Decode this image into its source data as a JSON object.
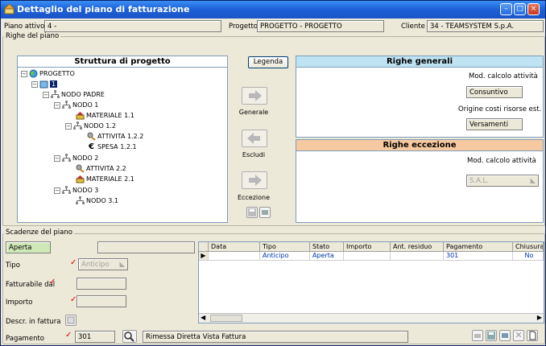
{
  "window": {
    "title": "Dettaglio del piano di fatturazione",
    "min": "–",
    "max": "□",
    "close": "×"
  },
  "header": {
    "piano_label": "Piano attivo",
    "piano_value": "4 -",
    "progetto_label": "Progetto",
    "progetto_value": "PROGETTO - PROGETTO",
    "cliente_label": "Cliente",
    "cliente_value": "34 - TEAMSYSTEM S.p.A."
  },
  "righe_group": "Righe del piano",
  "struttura": {
    "title": "Struttura di progetto",
    "legend_button": "Legenda",
    "nodes": [
      {
        "label": "PROGETTO",
        "icon": "project-icon"
      },
      {
        "label": "1",
        "icon": "package-icon"
      },
      {
        "label": "NODO PADRE",
        "icon": "node-icon"
      },
      {
        "label": "NODO 1",
        "icon": "node-icon"
      },
      {
        "label": "MATERIALE 1.1",
        "icon": "material-icon"
      },
      {
        "label": "NODO 1.2",
        "icon": "node-icon"
      },
      {
        "label": "ATTIVITA 1.2.2",
        "icon": "activity-icon"
      },
      {
        "label": "SPESA 1.2.1",
        "icon": "expense-icon"
      },
      {
        "label": "NODO 2",
        "icon": "node-icon"
      },
      {
        "label": "ATTIVITA 2.2",
        "icon": "activity-icon"
      },
      {
        "label": "MATERIALE 2.1",
        "icon": "material-icon"
      },
      {
        "label": "NODO 3",
        "icon": "node-icon"
      },
      {
        "label": "NODO 3.1",
        "icon": "node-icon"
      }
    ]
  },
  "actions": {
    "generale": "Generale",
    "escludi": "Escludi",
    "eccezione": "Eccezione"
  },
  "righe_generali": {
    "title": "Righe generali",
    "mod_calcolo_label": "Mod. calcolo attività",
    "mod_calcolo_value": "Consuntivo",
    "origine_label": "Origine costi risorse est.",
    "origine_value": "Versamenti"
  },
  "righe_eccezione": {
    "title": "Righe eccezione",
    "mod_calcolo_label": "Mod. calcolo attività",
    "mod_calcolo_value": "S.A.L."
  },
  "scadenze": {
    "group": "Scadenze del piano",
    "stato_value": "Aperta",
    "tipo_label": "Tipo",
    "tipo_value": "Anticipo",
    "fatturabile_label": "Fatturabile dal",
    "importo_label": "Importo",
    "descr_label": "Descr. in fattura",
    "pagamento_label": "Pagamento",
    "pagamento_value": "301",
    "pagamento_desc": "Rimessa Diretta Vista Fattura",
    "columns": [
      "Data",
      "Tipo",
      "Stato",
      "Importo",
      "Ant. residuo",
      "Pagamento",
      "Chiusura"
    ],
    "rows": [
      [
        "",
        "Anticipo",
        "Aperta",
        "",
        "",
        "301",
        "No"
      ]
    ]
  },
  "colors": {
    "accent": "#1d5fd6",
    "generali_head": "#bfe3f2",
    "eccezione_head": "#f7c9a0"
  }
}
